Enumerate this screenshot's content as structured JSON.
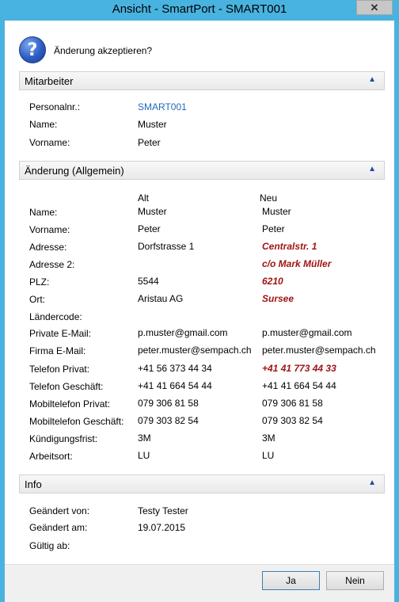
{
  "window": {
    "title": "Ansicht - SmartPort - SMART001",
    "close_label": "✕"
  },
  "prompt": "Änderung akzeptieren?",
  "sections": {
    "mitarbeiter": {
      "title": "Mitarbeiter",
      "rows": [
        {
          "label": "Personalnr.:",
          "value": "SMART001"
        },
        {
          "label": "Name:",
          "value": "Muster"
        },
        {
          "label": "Vorname:",
          "value": "Peter"
        }
      ]
    },
    "aenderung": {
      "title": "Änderung (Allgemein)",
      "col_alt": "Alt",
      "col_neu": "Neu",
      "rows": [
        {
          "label": "Name:",
          "alt": "Muster",
          "neu": "Muster"
        },
        {
          "label": "Vorname:",
          "alt": "Peter",
          "neu": "Peter"
        },
        {
          "label": "Adresse:",
          "alt": "Dorfstrasse 1",
          "neu": "Centralstr. 1"
        },
        {
          "label": "Adresse 2:",
          "alt": "",
          "neu": "c/o Mark Müller"
        },
        {
          "label": "PLZ:",
          "alt": "5544",
          "neu": "6210"
        },
        {
          "label": "Ort:",
          "alt": "Aristau AG",
          "neu": "Sursee"
        },
        {
          "label": "Ländercode:",
          "alt": "",
          "neu": ""
        },
        {
          "label": "Private E-Mail:",
          "alt": "p.muster@gmail.com",
          "neu": "p.muster@gmail.com"
        },
        {
          "label": "Firma E-Mail:",
          "alt": "peter.muster@sempach.ch",
          "neu": "peter.muster@sempach.ch"
        },
        {
          "label": "Telefon Privat:",
          "alt": "+41 56 373 44 34",
          "neu": "+41 41 773 44 33"
        },
        {
          "label": "Telefon Geschäft:",
          "alt": "+41 41 664 54 44",
          "neu": "+41 41 664 54 44"
        },
        {
          "label": "Mobiltelefon Privat:",
          "alt": "079 306 81 58",
          "neu": "079 306 81 58"
        },
        {
          "label": "Mobiltelefon Geschäft:",
          "alt": "079 303 82 54",
          "neu": "079 303 82 54"
        },
        {
          "label": "Kündigungsfrist:",
          "alt": "3M",
          "neu": "3M"
        },
        {
          "label": "Arbeitsort:",
          "alt": "LU",
          "neu": "LU"
        }
      ]
    },
    "info": {
      "title": "Info",
      "rows": [
        {
          "label": "Geändert von:",
          "value": "Testy Tester"
        },
        {
          "label": "Geändert am:",
          "value": "19.07.2015"
        },
        {
          "label": "Gültig ab:",
          "value": ""
        }
      ]
    }
  },
  "buttons": {
    "ja": "Ja",
    "nein": "Nein"
  },
  "colors": {
    "title_bar": "#49b3e0",
    "changed_value": "#a01414",
    "link": "#1e6bb8"
  },
  "icons": {
    "dialog": "question-icon",
    "collapse": "chevron-up-icon"
  }
}
